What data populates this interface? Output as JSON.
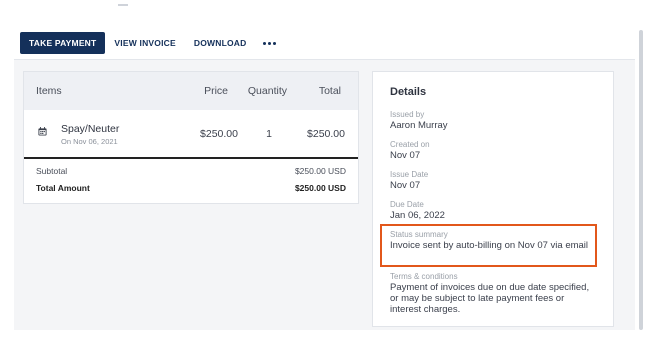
{
  "toolbar": {
    "take_payment": "TAKE PAYMENT",
    "view_invoice": "VIEW INVOICE",
    "download": "DOWNLOAD"
  },
  "items_table": {
    "headers": {
      "items": "Items",
      "price": "Price",
      "quantity": "Quantity",
      "total": "Total"
    },
    "rows": [
      {
        "name": "Spay/Neuter",
        "date": "On Nov 06, 2021",
        "price": "$250.00",
        "quantity": "1",
        "total": "$250.00",
        "icon": "calendar-icon"
      }
    ],
    "subtotal_label": "Subtotal",
    "subtotal_value": "$250.00 USD",
    "total_label": "Total Amount",
    "total_value": "$250.00 USD"
  },
  "details": {
    "title": "Details",
    "issued_by_label": "Issued by",
    "issued_by_value": "Aaron Murray",
    "created_on_label": "Created on",
    "created_on_value": "Nov 07",
    "issue_date_label": "Issue Date",
    "issue_date_value": "Nov 07",
    "due_date_label": "Due Date",
    "due_date_value": "Jan 06, 2022",
    "status_label": "Status summary",
    "status_value": "Invoice sent by auto-billing on Nov 07 via email",
    "terms_label": "Terms & conditions",
    "terms_value": "Payment of invoices due on due date specified, or may be subject to late payment fees or interest charges."
  },
  "colors": {
    "primary": "#14305a",
    "highlight": "#e2571b"
  }
}
